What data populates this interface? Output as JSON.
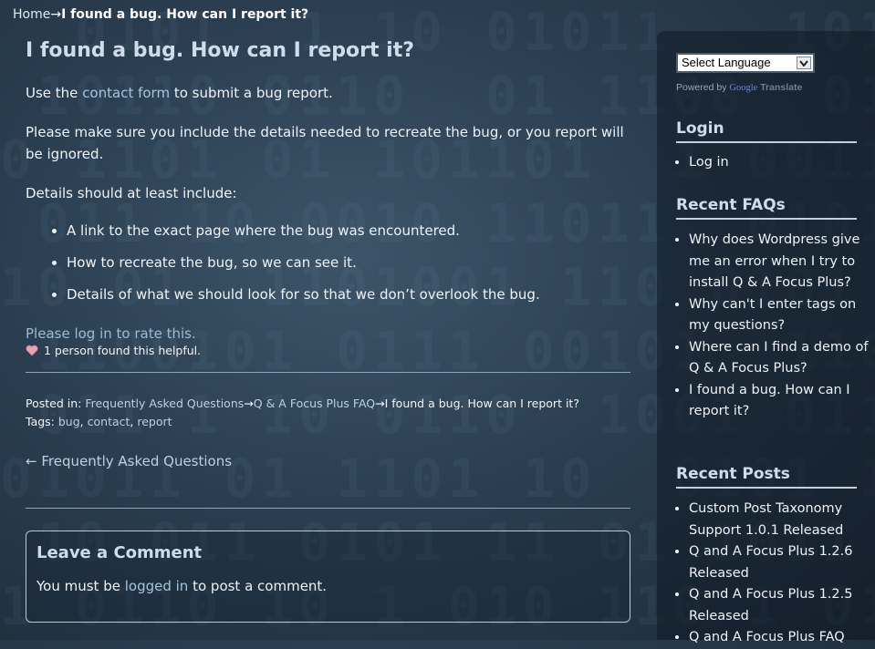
{
  "breadcrumb": {
    "home": "Home",
    "separator": "→",
    "current": "I found a bug. How can I report it?"
  },
  "post": {
    "title": "I found a bug. How can I report it?",
    "p1_before": "Use the ",
    "p1_link": "contact form",
    "p1_after": " to submit a bug report.",
    "p2": "Please make sure you include the details needed to recreate the bug, or you report will be ignored.",
    "p3": "Details should at least include:",
    "details": [
      "A link to the exact page where the bug was encountered.",
      "How to recreate the bug, so we can see it.",
      "Details of what we should look for so that we don’t overlook the bug."
    ],
    "rate_before": "Please ",
    "rate_link": "log in",
    "rate_after": " to rate this.",
    "helpful": "1 person found this helpful."
  },
  "meta": {
    "posted_label": "Posted in:",
    "category_1": "Frequently Asked Questions",
    "arrow": "→",
    "category_2": "Q & A Focus Plus FAQ",
    "current": "I found a bug. How can I report it?",
    "tags_label": "Tags:",
    "tags": [
      "bug",
      "contact",
      "report"
    ],
    "back_link": "← Frequently Asked Questions"
  },
  "comment": {
    "title": "Leave a Comment",
    "text_before": "You must be ",
    "text_link": "logged in",
    "text_after": " to post a comment."
  },
  "sidebar": {
    "language_select": "Select Language",
    "powered_by": "Powered by ",
    "google": "Google",
    "translate": "Translate",
    "login_title": "Login",
    "login_items": [
      "Log in"
    ],
    "faqs_title": "Recent FAQs",
    "faqs": [
      "Why does Wordpress give me an error when I try to install Q & A Focus Plus?",
      "Why can't I enter tags on my questions?",
      "Where can I find a demo of Q & A Focus Plus?",
      "I found a bug. How can I report it?"
    ],
    "posts_title": "Recent Posts",
    "posts": [
      "Custom Post Taxonomy Support 1.0.1 Released",
      "Q and A Focus Plus 1.2.6 Released",
      "Q and A Focus Plus 1.2.5 Released",
      "Q and A Focus Plus FAQ"
    ]
  },
  "colors": {
    "link": "#a9c4dc",
    "heading": "#cfdceb",
    "heart": "#e8a3b4"
  }
}
